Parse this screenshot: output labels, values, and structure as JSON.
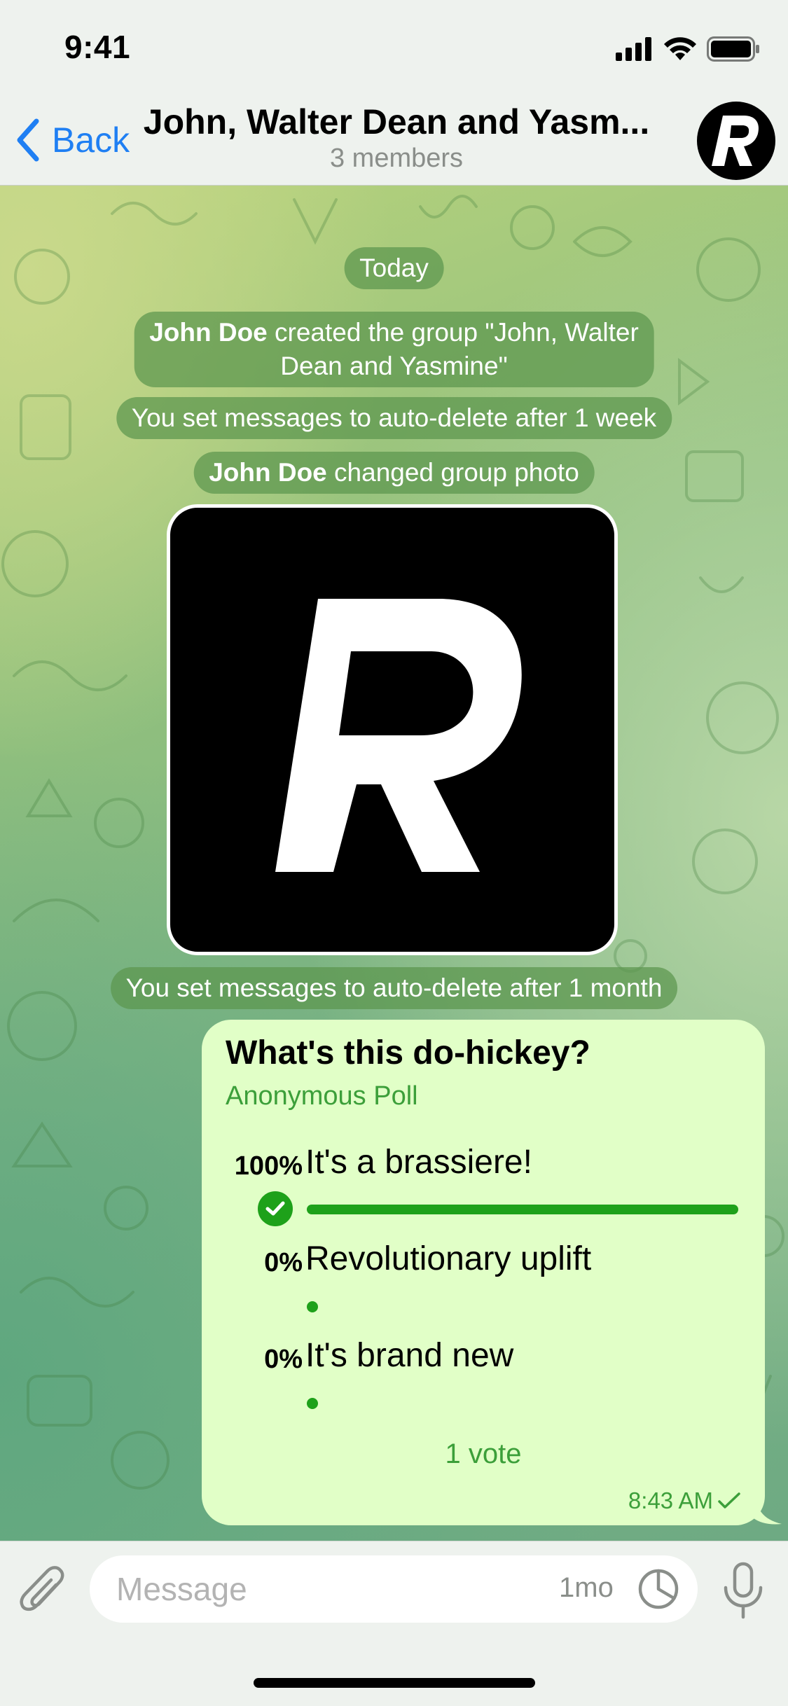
{
  "status_bar": {
    "time": "9:41"
  },
  "header": {
    "back_label": "Back",
    "title": "John, Walter Dean and Yasm...",
    "subtitle": "3 members",
    "avatar_letter": "R"
  },
  "messages": {
    "date_label": "Today",
    "service_1": {
      "actor": "John Doe",
      "text": " created the group \"John, Walter",
      "text_line2": "Dean and Yasmine\""
    },
    "service_2": {
      "text": "You set messages to auto-delete after 1 week"
    },
    "service_3": {
      "actor": "John Doe",
      "text": " changed group photo"
    },
    "group_photo_letter": "R",
    "service_4": {
      "text": "You set messages to auto-delete after 1 month"
    }
  },
  "poll": {
    "question": "What's this do-hickey?",
    "type_label": "Anonymous Poll",
    "options": [
      {
        "percent_label": "100%",
        "text": "It's a brassiere!",
        "fraction": 1.0,
        "selected": true
      },
      {
        "percent_label": "0%",
        "text": "Revolutionary uplift",
        "fraction": 0.0,
        "selected": false
      },
      {
        "percent_label": "0%",
        "text": "It's brand new",
        "fraction": 0.0,
        "selected": false
      }
    ],
    "votes_label": "1 vote",
    "time": "8:43 AM"
  },
  "input": {
    "placeholder": "Message",
    "timer_label": "1mo"
  },
  "colors": {
    "accent_blue": "#1f7ff3",
    "poll_green": "#1ea11a",
    "bubble_bg": "#e1ffc7"
  }
}
